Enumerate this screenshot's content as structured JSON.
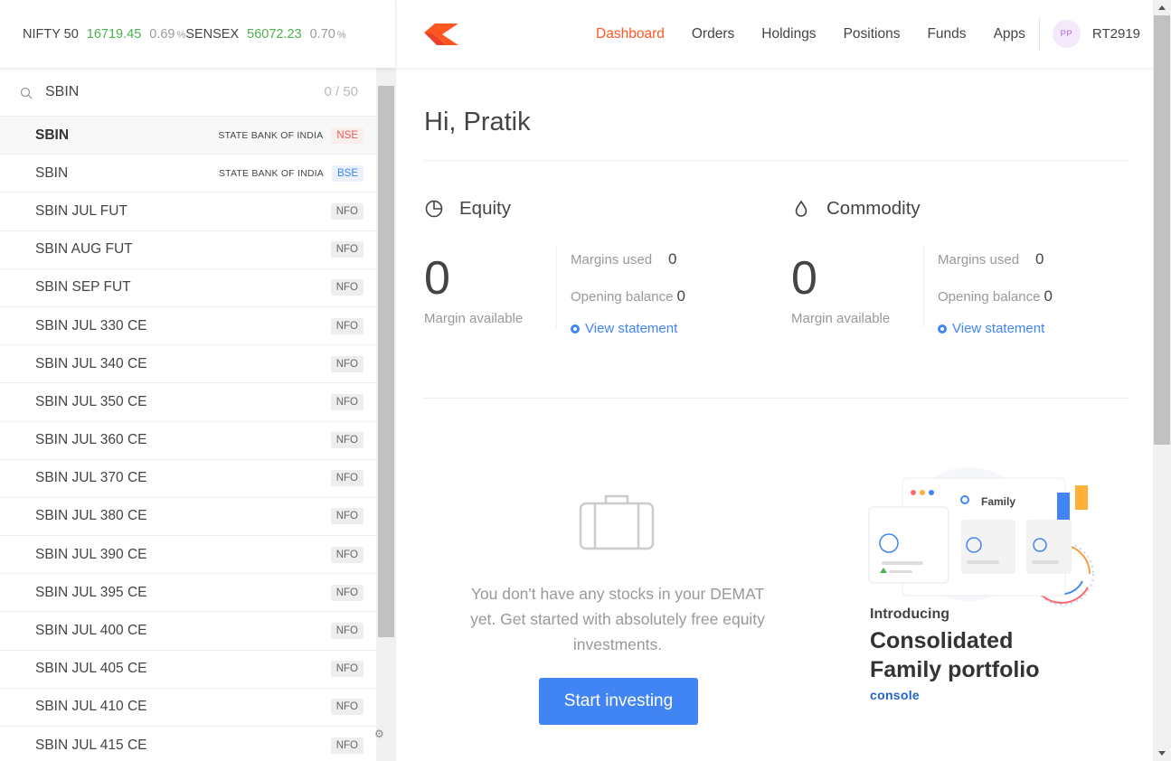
{
  "indices": [
    {
      "name": "NIFTY 50",
      "value": "16719.45",
      "change": "0.69",
      "unit": "%"
    },
    {
      "name": "SENSEX",
      "value": "56072.23",
      "change": "0.70",
      "unit": "%"
    }
  ],
  "nav": {
    "items": [
      "Dashboard",
      "Orders",
      "Holdings",
      "Positions",
      "Funds",
      "Apps"
    ],
    "active": "Dashboard",
    "avatar_initials": "PP",
    "user_id": "RT2919"
  },
  "search": {
    "value": "SBIN",
    "count": "0 / 50"
  },
  "results": [
    {
      "symbol": "SBIN",
      "fullname": "STATE BANK OF INDIA",
      "exchange": "NSE"
    },
    {
      "symbol": "SBIN",
      "fullname": "STATE BANK OF INDIA",
      "exchange": "BSE"
    },
    {
      "symbol": "SBIN JUL FUT",
      "fullname": "",
      "exchange": "NFO"
    },
    {
      "symbol": "SBIN AUG FUT",
      "fullname": "",
      "exchange": "NFO"
    },
    {
      "symbol": "SBIN SEP FUT",
      "fullname": "",
      "exchange": "NFO"
    },
    {
      "symbol": "SBIN JUL 330 CE",
      "fullname": "",
      "exchange": "NFO"
    },
    {
      "symbol": "SBIN JUL 340 CE",
      "fullname": "",
      "exchange": "NFO"
    },
    {
      "symbol": "SBIN JUL 350 CE",
      "fullname": "",
      "exchange": "NFO"
    },
    {
      "symbol": "SBIN JUL 360 CE",
      "fullname": "",
      "exchange": "NFO"
    },
    {
      "symbol": "SBIN JUL 370 CE",
      "fullname": "",
      "exchange": "NFO"
    },
    {
      "symbol": "SBIN JUL 380 CE",
      "fullname": "",
      "exchange": "NFO"
    },
    {
      "symbol": "SBIN JUL 390 CE",
      "fullname": "",
      "exchange": "NFO"
    },
    {
      "symbol": "SBIN JUL 395 CE",
      "fullname": "",
      "exchange": "NFO"
    },
    {
      "symbol": "SBIN JUL 400 CE",
      "fullname": "",
      "exchange": "NFO"
    },
    {
      "symbol": "SBIN JUL 405 CE",
      "fullname": "",
      "exchange": "NFO"
    },
    {
      "symbol": "SBIN JUL 410 CE",
      "fullname": "",
      "exchange": "NFO"
    },
    {
      "symbol": "SBIN JUL 415 CE",
      "fullname": "",
      "exchange": "NFO"
    }
  ],
  "dashboard": {
    "greeting": "Hi, Pratik",
    "equity": {
      "title": "Equity",
      "margin_available": "0",
      "margin_available_label": "Margin available",
      "margins_used_label": "Margins used",
      "margins_used": "0",
      "opening_balance_label": "Opening balance",
      "opening_balance": "0",
      "view_statement": "View statement"
    },
    "commodity": {
      "title": "Commodity",
      "margin_available": "0",
      "margin_available_label": "Margin available",
      "margins_used_label": "Margins used",
      "margins_used": "0",
      "opening_balance_label": "Opening balance",
      "opening_balance": "0",
      "view_statement": "View statement"
    },
    "empty_message": "You don't have any stocks in your DEMAT yet. Get started with absolutely free equity investments.",
    "start_button": "Start investing"
  },
  "promo": {
    "card_label": "Family",
    "introducing": "Introducing",
    "title_line1": "Consolidated",
    "title_line2": "Family portfolio",
    "brand": "console"
  },
  "colors": {
    "brand": "#ff5722",
    "positive": "#4caf50",
    "link": "#4184f3",
    "nse": "#e85a5a",
    "bse": "#4184f3"
  }
}
